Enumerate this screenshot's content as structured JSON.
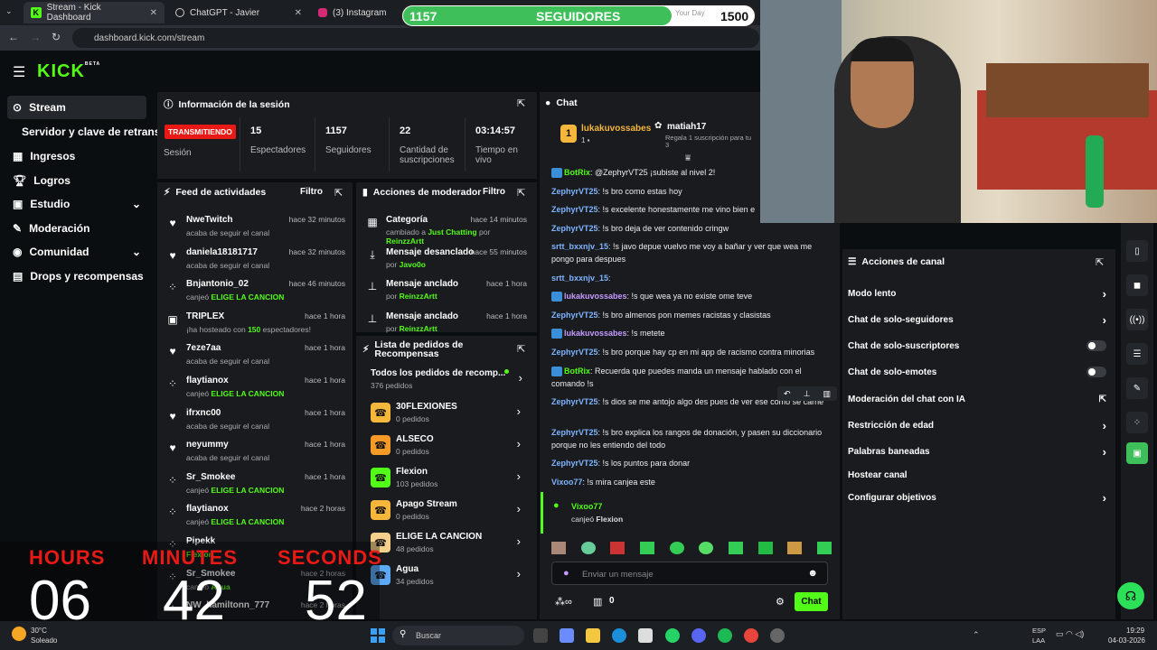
{
  "browser": {
    "tabs": [
      {
        "title": "Stream - Kick Dashboard"
      },
      {
        "title": "ChatGPT - Javier"
      },
      {
        "title": "(3) Instagram"
      }
    ],
    "url": "dashboard.kick.com/stream"
  },
  "overlay": {
    "followers_current": "1157",
    "followers_label": "SEGUIDORES",
    "followers_goal": "1500",
    "your_day": "Your Day",
    "progress": 0.77
  },
  "brand": {
    "logo": "KICK",
    "beta": "BETA"
  },
  "sidebar": {
    "items": [
      {
        "label": "Stream",
        "icon": "stream-icon"
      },
      {
        "label": "Servidor y clave de retransm"
      },
      {
        "label": "Ingresos",
        "icon": "table-icon"
      },
      {
        "label": "Logros",
        "icon": "trophy-icon"
      },
      {
        "label": "Estudio",
        "icon": "studio-icon"
      },
      {
        "label": "Moderación",
        "icon": "wrench-icon"
      },
      {
        "label": "Comunidad",
        "icon": "community-icon"
      },
      {
        "label": "Drops y recompensas",
        "icon": "drops-icon"
      }
    ]
  },
  "session": {
    "title": "Información de la sesión",
    "status": "TRANSMITIENDO",
    "status_label": "Sesión",
    "viewers": "15",
    "viewers_label": "Espectadores",
    "followers": "1157",
    "followers_label": "Seguidores",
    "subs": "22",
    "subs_label": "Cantidad de suscripciones",
    "time": "03:14:57",
    "time_label": "Tiempo en vivo"
  },
  "feed": {
    "title": "Feed de actividades",
    "filter": "Filtro",
    "items": [
      {
        "name": "NweTwitch",
        "time": "hace 32 minutos",
        "sub": "acaba de seguir el canal",
        "icon": "heart-icon"
      },
      {
        "name": "daniela18181717",
        "time": "hace 32 minutos",
        "sub": "acaba de seguir el canal",
        "icon": "heart-icon"
      },
      {
        "name": "Bnjantonio_02",
        "time": "hace 46 minutos",
        "sub_pre": "canjeó ",
        "sub_hl": "ELIGE LA CANCION",
        "icon": "redeem-icon"
      },
      {
        "name": "TRIPLEX",
        "time": "hace 1 hora",
        "sub_pre": "¡ha hosteado con ",
        "sub_hl": "150",
        "sub_post": " espectadores!",
        "icon": "host-icon"
      },
      {
        "name": "7eze7aa",
        "time": "hace 1 hora",
        "sub": "acaba de seguir el canal",
        "icon": "heart-icon"
      },
      {
        "name": "flaytianox",
        "time": "hace 1 hora",
        "sub_pre": "canjeó ",
        "sub_hl": "ELIGE LA CANCION",
        "icon": "redeem-icon"
      },
      {
        "name": "ifrxnc00",
        "time": "hace 1 hora",
        "sub": "acaba de seguir el canal",
        "icon": "heart-icon"
      },
      {
        "name": "neyummy",
        "time": "hace 1 hora",
        "sub": "acaba de seguir el canal",
        "icon": "heart-icon"
      },
      {
        "name": "Sr_Smokee",
        "time": "hace 1 hora",
        "sub_pre": "canjeó ",
        "sub_hl": "ELIGE LA CANCION",
        "icon": "redeem-icon"
      },
      {
        "name": "flaytianox",
        "time": "hace 2 horas",
        "sub_pre": "canjeó ",
        "sub_hl": "ELIGE LA CANCION",
        "icon": "redeem-icon"
      },
      {
        "name": "Pipekk",
        "time": "",
        "sub_pre": "",
        "sub_hl": "Flexion",
        "icon": "redeem-icon"
      },
      {
        "name": "Sr_Smokee",
        "time": "hace 2 horas",
        "sub_pre": "canjeó ",
        "sub_hl": "Agua",
        "icon": "redeem-icon"
      },
      {
        "name": "NW_hamiltonn_777",
        "time": "hace 2 horas",
        "sub": "",
        "icon": "redeem-icon"
      }
    ]
  },
  "mod": {
    "title": "Acciones de moderador",
    "filter": "Filtro",
    "items": [
      {
        "name": "Categoría",
        "time": "hace 14 minutos",
        "sub_pre": "cambiado a ",
        "sub_hl": "Just Chatting",
        "sub_mid": " por ",
        "sub_hl2": "ReinzzArtt",
        "icon": "category-icon"
      },
      {
        "name": "Mensaje desanclado",
        "time": "hace 55 minutos",
        "sub_pre": "por ",
        "sub_hl": "Javo0o",
        "icon": "unpin-icon"
      },
      {
        "name": "Mensaje anclado",
        "time": "hace 1 hora",
        "sub_pre": "por ",
        "sub_hl": "ReinzzArtt",
        "icon": "pin-icon"
      },
      {
        "name": "Mensaje anclado",
        "time": "hace 1 hora",
        "sub_pre": "por ",
        "sub_hl": "ReinzzArtt",
        "icon": "pin-icon"
      }
    ]
  },
  "rewards": {
    "title": "Lista de pedidos de Recompensas",
    "all_label": "Todos los pedidos de recomp...",
    "all_count": "376 pedidos",
    "items": [
      {
        "name": "30FLEXIONES",
        "count": "0 pedidos",
        "color": "#f5b63c"
      },
      {
        "name": "ALSECO",
        "count": "0 pedidos",
        "color": "#f59a26"
      },
      {
        "name": "Flexion",
        "count": "103 pedidos",
        "color": "#53fc18"
      },
      {
        "name": "Apago Stream",
        "count": "0 pedidos",
        "color": "#f5b63c"
      },
      {
        "name": "ELIGE LA CANCION",
        "count": "48 pedidos",
        "color": "#f5d08a"
      },
      {
        "name": "Agua",
        "count": "34 pedidos",
        "color": "#5ba8f5"
      }
    ]
  },
  "chat": {
    "title": "Chat",
    "pinned_user": "lukakuvossabes",
    "pinned_num": "1",
    "gift_user": "matiah17",
    "gift_text": "Regala 1 suscripción para tu",
    "gift_num": "3",
    "messages": [
      {
        "user": "BotRix",
        "text": ": @ZephyrVT25 ¡subiste al nivel 2!",
        "cls": "g"
      },
      {
        "user": "ZephyrVT25",
        "text": ": !s bro como estas hoy",
        "cls": ""
      },
      {
        "user": "ZephyrVT25",
        "text": ": !s excelente honestamente me vino bien e",
        "cls": ""
      },
      {
        "user": "ZephyrVT25",
        "text": ": !s bro deja de ver contenido cringw",
        "cls": ""
      },
      {
        "user": "srtt_bxxnjv_15",
        "text": ": !s javo depue vuelvo me voy a bañar y ver que wea me pongo para despues",
        "cls": ""
      },
      {
        "user": "srtt_bxxnjv_15",
        "text": ":",
        "cls": ""
      },
      {
        "user": "lukakuvossabes",
        "text": ": !s que wea ya no existe ome teve",
        "cls": "p"
      },
      {
        "user": "ZephyrVT25",
        "text": ": !s bro almenos pon memes racistas y clasistas",
        "cls": ""
      },
      {
        "user": "lukakuvossabes",
        "text": ": !s metete",
        "cls": "p"
      },
      {
        "user": "ZephyrVT25",
        "text": ": !s bro porque hay cp en mi app de racismo contra minorias",
        "cls": ""
      },
      {
        "user": "BotRix",
        "text": ": Recuerda que puedes manda un mensaje hablado con el comando !s",
        "cls": "g"
      },
      {
        "user": "ZephyrVT25",
        "text": ": !s dios se me antojo algo des pues de ver ese como se carne",
        "cls": ""
      },
      {
        "user": "ZephyrVT25",
        "text": ": !s bro explica los rangos de donación, y pasen su diccionario porque no les entiendo del todo",
        "cls": ""
      },
      {
        "user": "ZephyrVT25",
        "text": ": !s los puntos para donar",
        "cls": ""
      },
      {
        "user": "Vixoo77",
        "text": ": !s mira canjea este",
        "cls": ""
      }
    ],
    "redeem_user": "Vixoo77",
    "redeem_text": "canjeó ",
    "redeem_item": "Flexion",
    "placeholder": "Enviar un mensaje",
    "points": "0",
    "send": "Chat"
  },
  "channel_actions": {
    "title": "Acciones de canal",
    "items": [
      {
        "label": "Modo lento",
        "ctrl": "arrow"
      },
      {
        "label": "Chat de solo-seguidores",
        "ctrl": "arrow"
      },
      {
        "label": "Chat de solo-suscriptores",
        "ctrl": "toggle"
      },
      {
        "label": "Chat de solo-emotes",
        "ctrl": "toggle"
      },
      {
        "label": "Moderación del chat con IA",
        "ctrl": "ext"
      },
      {
        "label": "Restricción de edad",
        "ctrl": "arrow"
      },
      {
        "label": "Palabras baneadas",
        "ctrl": "arrow"
      },
      {
        "label": "Hostear canal",
        "ctrl": "none"
      },
      {
        "label": "Configurar objetivos",
        "ctrl": "arrow"
      }
    ]
  },
  "timer": {
    "hours_label": "HOURS",
    "minutes_label": "MINUTES",
    "seconds_label": "SECONDS",
    "hours": "06",
    "minutes": "42",
    "seconds": "52"
  },
  "taskbar": {
    "weather_temp": "30°C",
    "weather_text": "Soleado",
    "search": "Buscar",
    "lang1": "ESP",
    "lang2": "LAA",
    "time": "19:29",
    "date": "04-03-2026"
  },
  "colors": {
    "accent": "#53fc18",
    "live": "#e91916",
    "panel": "#191b1f",
    "bg": "#0b0e11"
  }
}
